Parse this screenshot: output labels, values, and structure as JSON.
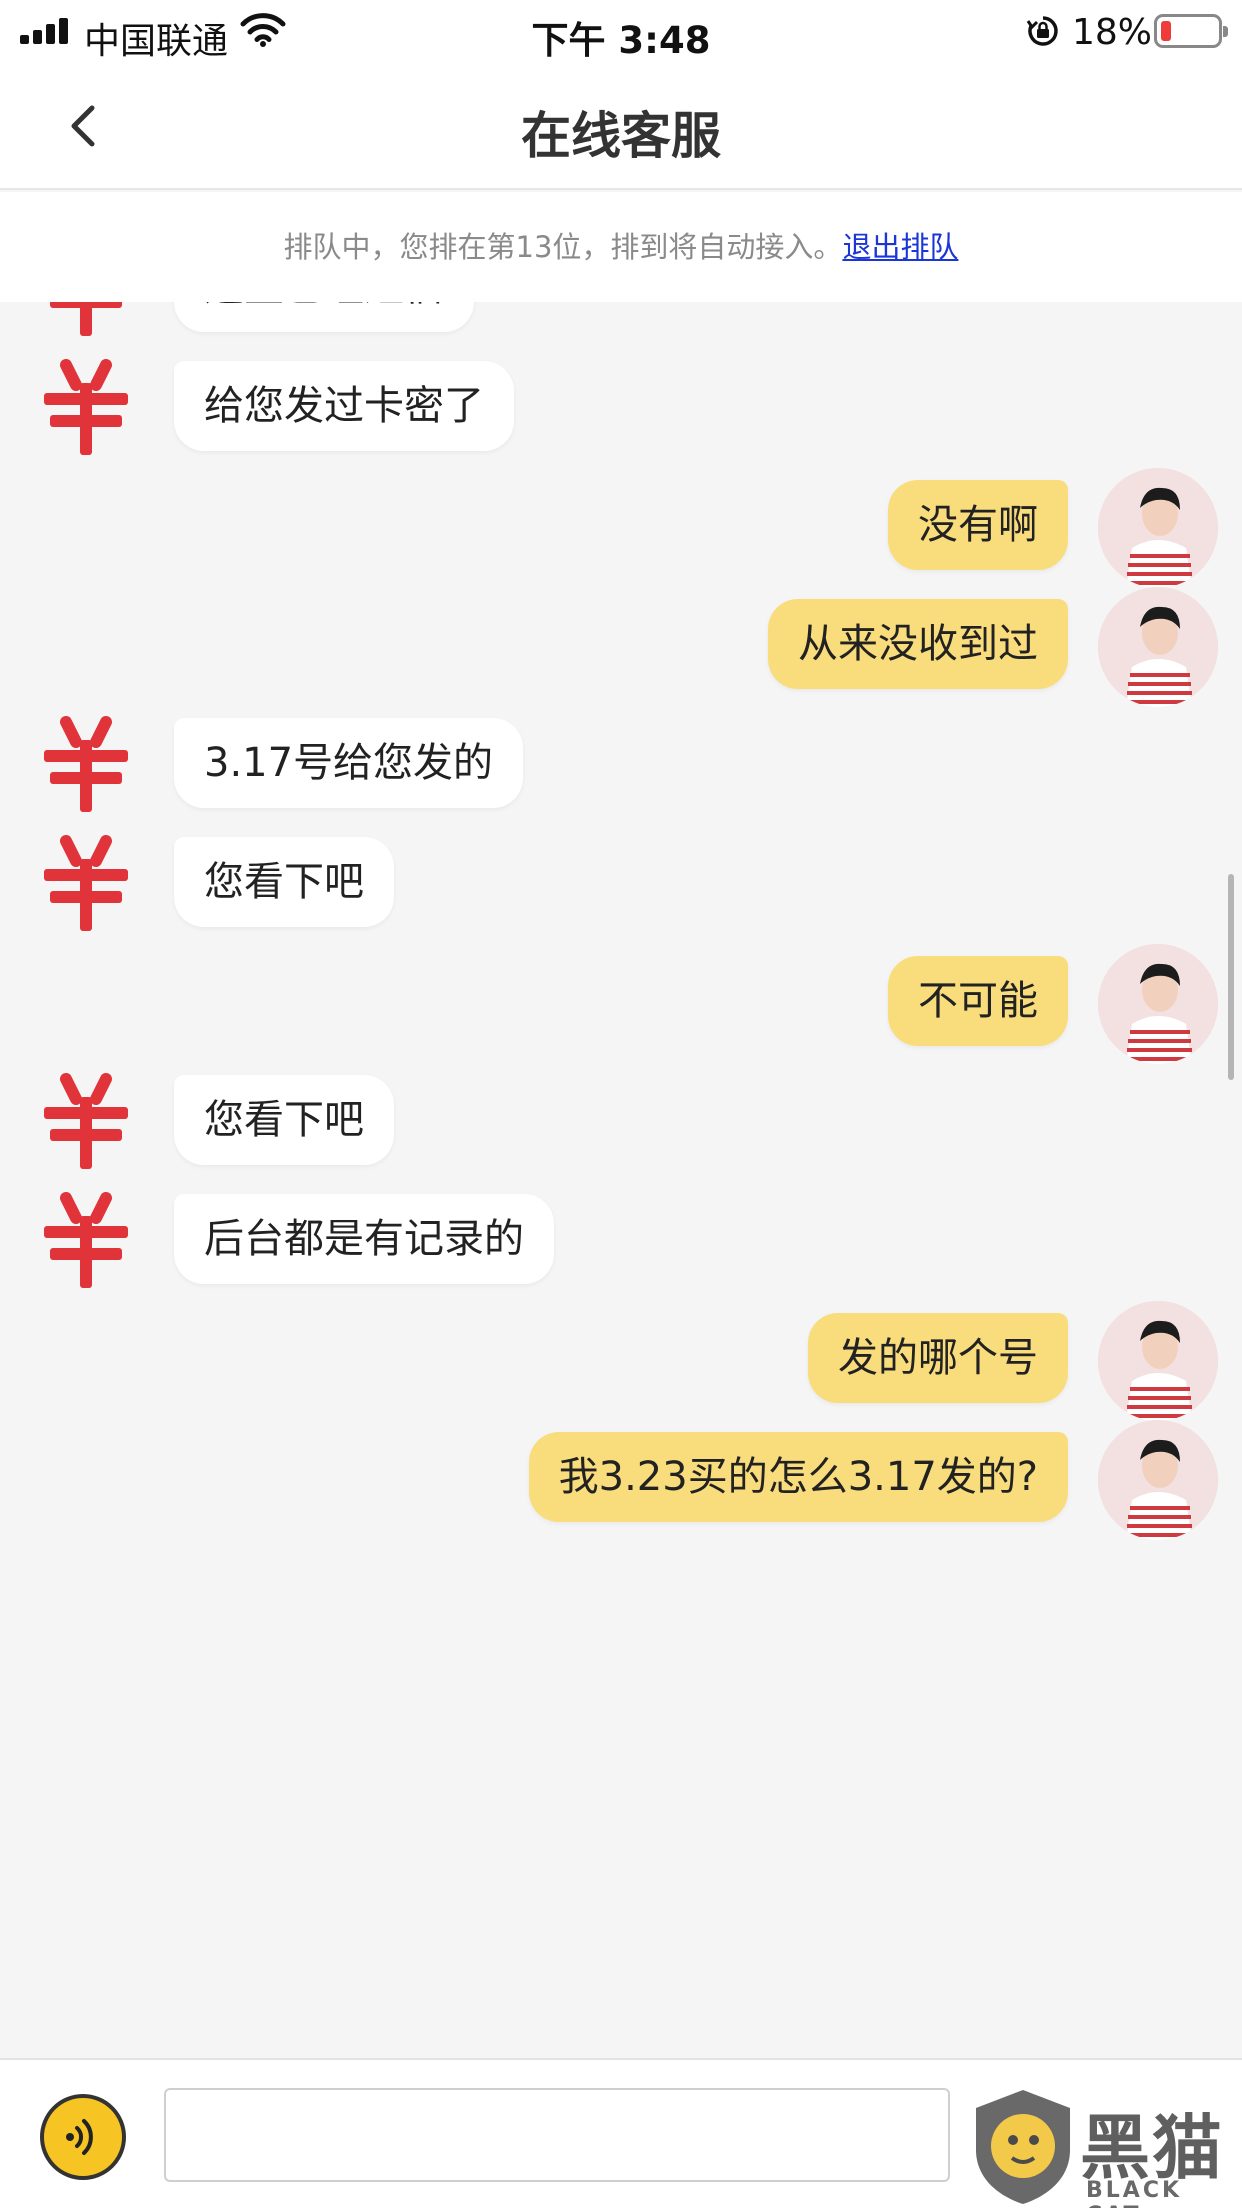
{
  "status_bar": {
    "carrier": "中国联通",
    "time": "下午 3:48",
    "battery_percent": "18%",
    "battery_level": 0.18,
    "battery_level_color": "#f03b3b"
  },
  "nav": {
    "title": "在线客服",
    "back_icon": "chevron-left-icon"
  },
  "queue": {
    "notice": "排队中，您排在第13位，排到将自动接入。",
    "exit_link": "退出排队"
  },
  "colors": {
    "agent_bubble": "#ffffff",
    "user_bubble": "#f9dd7c",
    "agent_avatar": "#e0333a",
    "link": "#1a35d8"
  },
  "messages": [
    {
      "sender": "agent",
      "text": "这里已经短信"
    },
    {
      "sender": "agent",
      "text": "给您发过卡密了"
    },
    {
      "sender": "user",
      "text": "没有啊"
    },
    {
      "sender": "user",
      "text": "从来没收到过"
    },
    {
      "sender": "agent",
      "text": "3.17号给您发的"
    },
    {
      "sender": "agent",
      "text": "您看下吧"
    },
    {
      "sender": "user",
      "text": "不可能"
    },
    {
      "sender": "agent",
      "text": "您看下吧"
    },
    {
      "sender": "agent",
      "text": "后台都是有记录的"
    },
    {
      "sender": "user",
      "text": "发的哪个号"
    },
    {
      "sender": "user",
      "text": "我3.23买的怎么3.17发的?"
    }
  ],
  "input_bar": {
    "voice_icon": "voice-icon",
    "input_value": "",
    "input_placeholder": ""
  },
  "watermark": {
    "text": "黑猫",
    "subtext": "BLACK CAT"
  }
}
